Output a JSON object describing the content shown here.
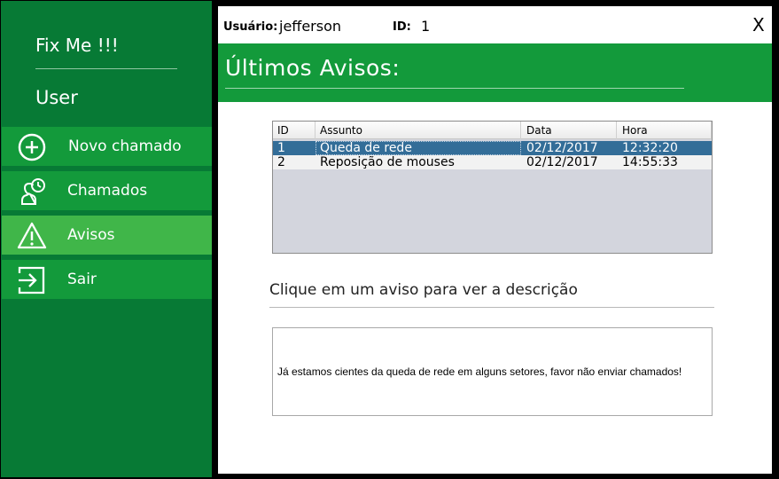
{
  "sidebar": {
    "brand": "Fix Me !!!",
    "user": "User",
    "items": [
      {
        "label": "Novo chamado",
        "icon": "plus-circle-icon"
      },
      {
        "label": "Chamados",
        "icon": "person-clock-icon"
      },
      {
        "label": "Avisos",
        "icon": "warning-triangle-icon",
        "active": true
      },
      {
        "label": "Sair",
        "icon": "exit-icon"
      }
    ]
  },
  "header": {
    "usuario_label": "Usuário:",
    "usuario_value": "jefferson",
    "id_label": "ID:",
    "id_value": "1",
    "close": "X"
  },
  "banner": {
    "title": "Últimos  Avisos:"
  },
  "grid": {
    "columns": [
      "ID",
      "Assunto",
      "Data",
      "Hora"
    ],
    "rows": [
      {
        "id": "1",
        "assunto": "Queda de rede",
        "data": "02/12/2017",
        "hora": "12:32:20",
        "selected": true
      },
      {
        "id": "2",
        "assunto": "Reposição de mouses",
        "data": "02/12/2017",
        "hora": "14:55:33",
        "selected": false
      }
    ]
  },
  "hint": "Clique em um aviso para ver a descrição",
  "description": "Já estamos cientes da queda de rede em alguns setores, favor não enviar chamados!",
  "colors": {
    "sidebar_bg": "#077a35",
    "nav_bg": "#139a3b",
    "nav_active": "#40b649",
    "banner_bg": "#139a3b",
    "selected_row": "#336d98"
  }
}
